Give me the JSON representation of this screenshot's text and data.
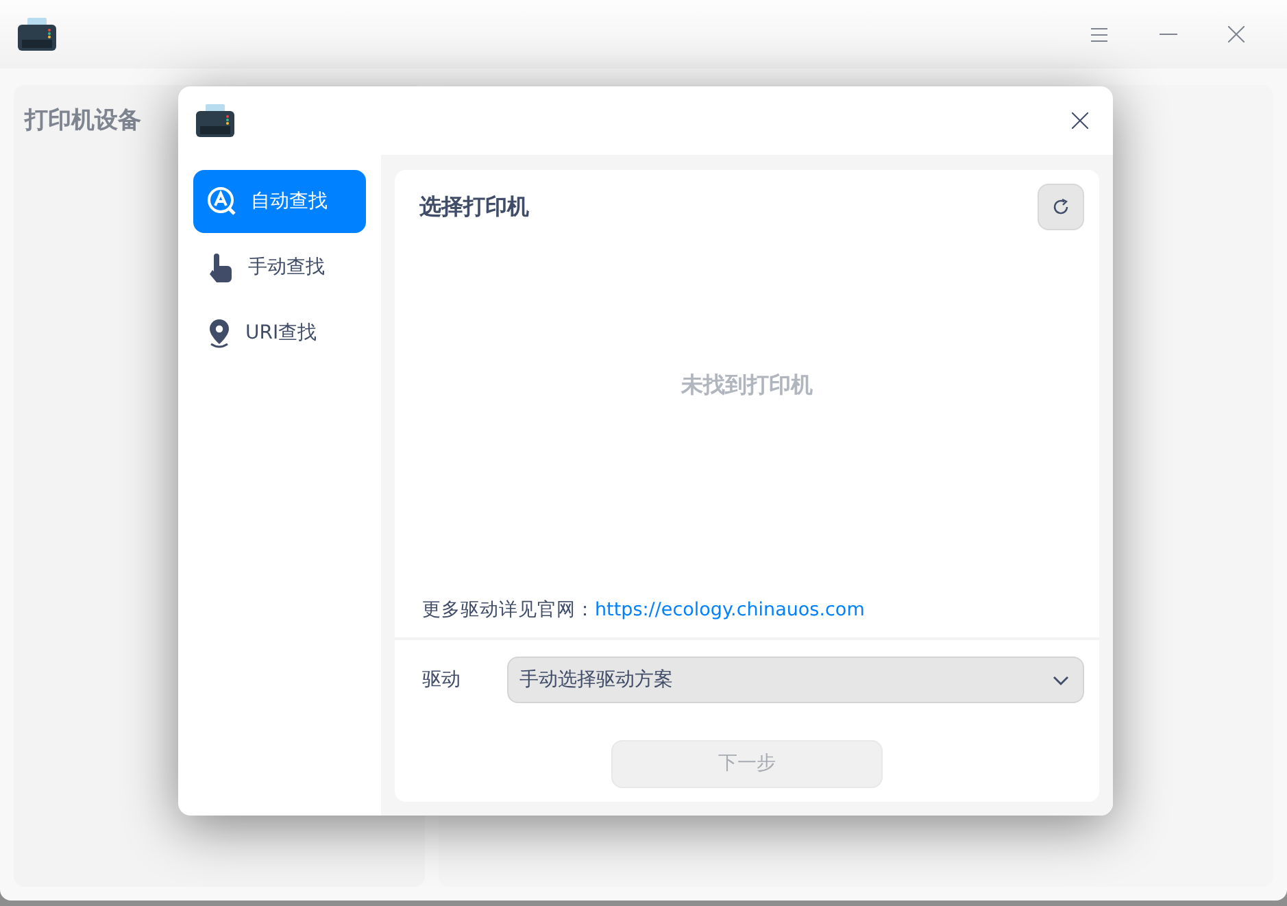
{
  "main_window": {
    "sidebar_title": "打印机设备"
  },
  "dialog": {
    "nav": [
      {
        "label": "自动查找",
        "kind": "auto",
        "selected": true
      },
      {
        "label": "手动查找",
        "kind": "manual",
        "selected": false
      },
      {
        "label": "URI查找",
        "kind": "uri",
        "selected": false
      }
    ],
    "title": "选择打印机",
    "empty_message": "未找到打印机",
    "driver_note": {
      "text": "更多驱动详见官网：",
      "link": "https://ecology.chinauos.com"
    },
    "driver": {
      "label": "驱动",
      "value": "手动选择驱动方案"
    },
    "next_button": {
      "label": "下一步",
      "disabled": true
    }
  }
}
